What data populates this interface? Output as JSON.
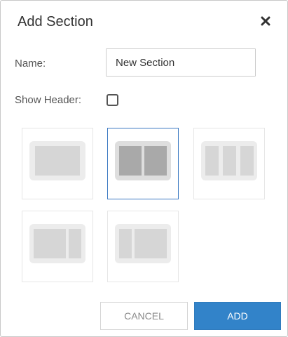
{
  "dialog": {
    "title": "Add Section",
    "close_icon": "close-icon"
  },
  "form": {
    "name_label": "Name:",
    "name_value": "New Section",
    "show_header_label": "Show Header:",
    "show_header_checked": false
  },
  "layouts": {
    "options": [
      {
        "name": "single-column",
        "selected": false
      },
      {
        "name": "two-equal-columns",
        "selected": true
      },
      {
        "name": "three-columns",
        "selected": false
      },
      {
        "name": "wide-left-narrow-right",
        "selected": false
      },
      {
        "name": "narrow-left-wide-right",
        "selected": false
      }
    ]
  },
  "buttons": {
    "cancel_label": "CANCEL",
    "add_label": "ADD"
  },
  "colors": {
    "primary": "#3283c9",
    "selected_border": "#3a78c2"
  }
}
